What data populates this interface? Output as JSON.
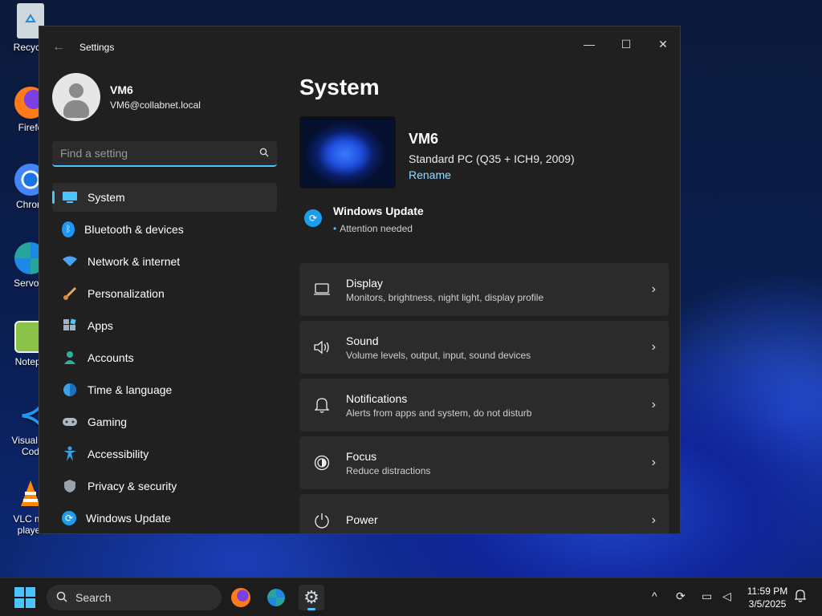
{
  "desktop": {
    "icons": [
      {
        "label": "Recycle",
        "icon": "recycle-bin-icon"
      },
      {
        "label": "Firefo",
        "icon": "firefox-icon"
      },
      {
        "label": "Chrom",
        "icon": "chrome-icon"
      },
      {
        "label": "Servo T",
        "icon": "servo-icon"
      },
      {
        "label": "Notepa",
        "icon": "notepad-icon"
      },
      {
        "label": "Visual St\nCod",
        "icon": "vscode-icon"
      },
      {
        "label": "VLC me\nplayer",
        "icon": "vlc-icon"
      }
    ]
  },
  "window": {
    "title": "Settings",
    "controls": {
      "minimize": "—",
      "maximize": "☐",
      "close": "✕"
    }
  },
  "profile": {
    "name": "VM6",
    "email": "VM6@collabnet.local"
  },
  "search": {
    "placeholder": "Find a setting"
  },
  "nav": {
    "items": [
      {
        "label": "System",
        "icon": "system-icon",
        "active": true
      },
      {
        "label": "Bluetooth & devices",
        "icon": "bluetooth-icon"
      },
      {
        "label": "Network & internet",
        "icon": "wifi-icon"
      },
      {
        "label": "Personalization",
        "icon": "brush-icon"
      },
      {
        "label": "Apps",
        "icon": "apps-icon"
      },
      {
        "label": "Accounts",
        "icon": "accounts-icon"
      },
      {
        "label": "Time & language",
        "icon": "globe-icon"
      },
      {
        "label": "Gaming",
        "icon": "gamepad-icon"
      },
      {
        "label": "Accessibility",
        "icon": "accessibility-icon"
      },
      {
        "label": "Privacy & security",
        "icon": "shield-icon"
      },
      {
        "label": "Windows Update",
        "icon": "update-icon"
      }
    ]
  },
  "main": {
    "title": "System",
    "device": {
      "name": "VM6",
      "spec": "Standard PC (Q35 + ICH9, 2009)",
      "rename": "Rename"
    },
    "update": {
      "title": "Windows Update",
      "status": "Attention needed"
    },
    "cards": [
      {
        "title": "Display",
        "subtitle": "Monitors, brightness, night light, display profile",
        "icon": "monitor-icon"
      },
      {
        "title": "Sound",
        "subtitle": "Volume levels, output, input, sound devices",
        "icon": "speaker-icon"
      },
      {
        "title": "Notifications",
        "subtitle": "Alerts from apps and system, do not disturb",
        "icon": "bell-icon"
      },
      {
        "title": "Focus",
        "subtitle": "Reduce distractions",
        "icon": "focus-icon"
      },
      {
        "title": "Power",
        "subtitle": "",
        "icon": "power-icon"
      }
    ]
  },
  "taskbar": {
    "search_label": "Search",
    "time": "11:59 PM",
    "date": "3/5/2025"
  },
  "colors": {
    "accent": "#4cc2ff",
    "window_bg": "#202020",
    "card_bg": "#2b2b2b"
  }
}
